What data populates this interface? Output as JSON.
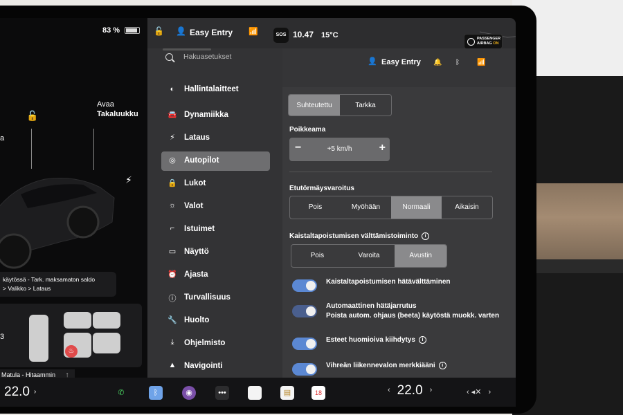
{
  "status_bar": {
    "battery": "83 %",
    "profile": "Easy Entry",
    "sos": "SOS",
    "time": "10.47",
    "temperature": "15°C",
    "airbag_line1": "PASSENGER",
    "airbag_line2": "AIRBAG",
    "airbag_status": "ON"
  },
  "car_panel": {
    "open_trunk_line1": "Avaa",
    "open_trunk_line2": "Takaluukku",
    "left_label": "a",
    "notice_line1": "käytössä - Tark. maksamaton saldo",
    "notice_line2": "> Valikko > Lataus",
    "seat_temp": "3",
    "drive_mode": "Matula - Hitaammin"
  },
  "sidebar": {
    "search_placeholder": "Hakuasetukset",
    "items": [
      {
        "label": "Hallintalaitteet",
        "icon": "controls-icon"
      },
      {
        "label": "Dynamiikka",
        "icon": "car-icon"
      },
      {
        "label": "Lataus",
        "icon": "bolt-icon"
      },
      {
        "label": "Autopilot",
        "icon": "steering-wheel-icon",
        "active": true
      },
      {
        "label": "Lukot",
        "icon": "lock-icon"
      },
      {
        "label": "Valot",
        "icon": "sun-icon"
      },
      {
        "label": "Istuimet",
        "icon": "seat-icon"
      },
      {
        "label": "Näyttö",
        "icon": "display-icon"
      },
      {
        "label": "Ajasta",
        "icon": "alarm-icon"
      },
      {
        "label": "Turvallisuus",
        "icon": "info-circle-icon"
      },
      {
        "label": "Huolto",
        "icon": "wrench-icon"
      },
      {
        "label": "Ohjelmisto",
        "icon": "download-icon"
      },
      {
        "label": "Navigointi",
        "icon": "navigation-icon"
      }
    ]
  },
  "content": {
    "profile": "Easy Entry",
    "offset_mode": {
      "options": [
        "Suhteutettu",
        "Tarkka"
      ],
      "selected": "Suhteutettu"
    },
    "offset_label": "Poikkeama",
    "offset_value": "+5 km/h",
    "fcw_label": "Etutörmäysvaroitus",
    "fcw": {
      "options": [
        "Pois",
        "Myöhään",
        "Normaali",
        "Aikaisin"
      ],
      "selected": "Normaali"
    },
    "lane_label": "Kaistaltapoistumisen välttämistoiminto",
    "lane": {
      "options": [
        "Pois",
        "Varoita",
        "Avustin"
      ],
      "selected": "Avustin"
    },
    "toggles": [
      {
        "label": "Kaistaltapoistumisen hätävälttäminen",
        "on": true
      },
      {
        "label": "Automaattinen hätäjarrutus",
        "sub": "Poista autom. ohjaus (beeta) käytöstä muokk. varten",
        "on": true
      },
      {
        "label": "Esteet huomioiva kiihdytys",
        "on": true,
        "info": true
      },
      {
        "label": "Vihreän liikennevalon merkkiääni",
        "on": true,
        "info": true
      }
    ]
  },
  "dock": {
    "left_temp": "22.0",
    "left_temp_arrow": "›",
    "right_temp": "22.0",
    "calendar_day": "18",
    "volume": "◂✕",
    "left_chev": "‹",
    "right_chev": "›",
    "vol_chev": "›"
  },
  "colors": {
    "accent": "#5b88d3",
    "panel": "#3a3a3c",
    "sidebar": "#333335",
    "active": "#6e6e70"
  }
}
